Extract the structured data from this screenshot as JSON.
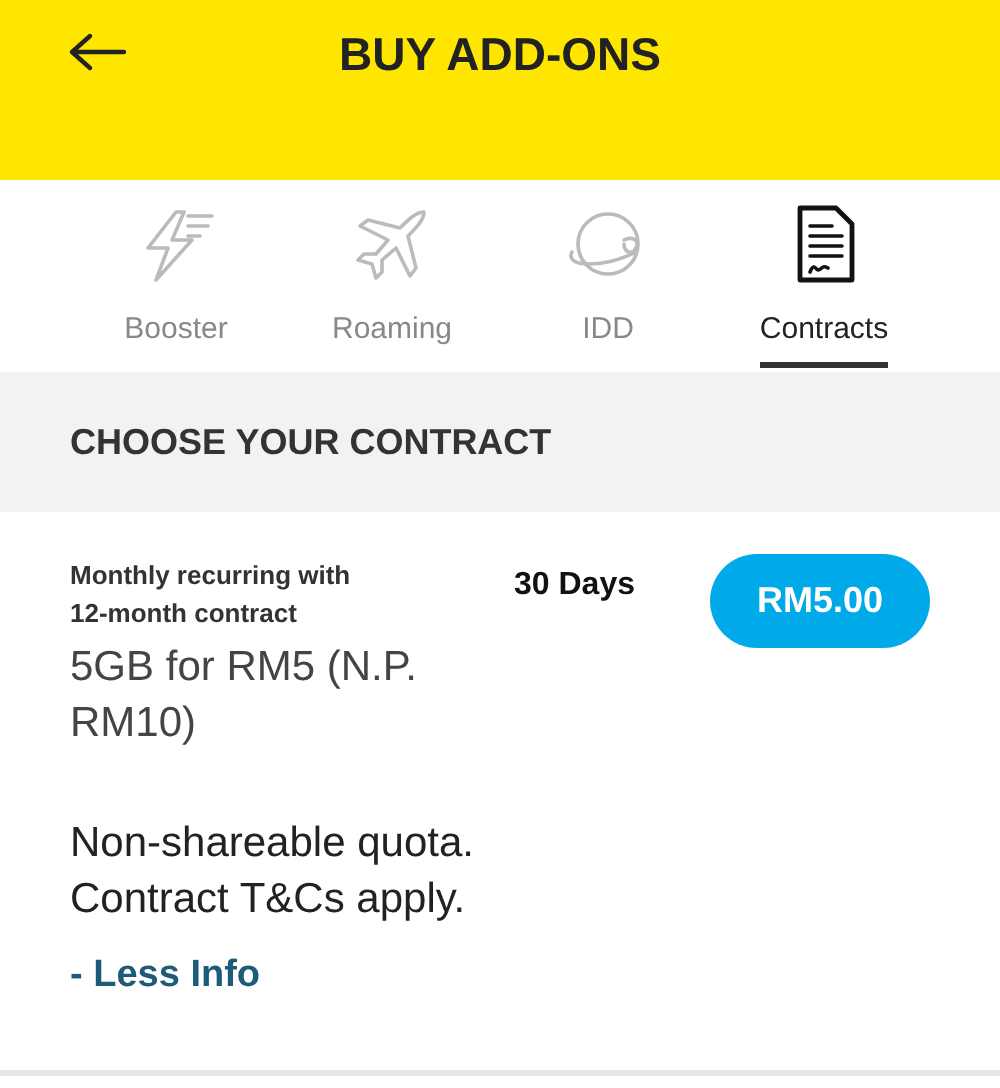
{
  "header": {
    "title": "BUY ADD-ONS"
  },
  "tabs": [
    {
      "label": "Booster",
      "kind": "booster",
      "selected": false
    },
    {
      "label": "Roaming",
      "kind": "roaming",
      "selected": false
    },
    {
      "label": "IDD",
      "kind": "idd",
      "selected": false
    },
    {
      "label": "Contracts",
      "kind": "contracts",
      "selected": true
    }
  ],
  "section": {
    "title": "CHOOSE YOUR CONTRACT"
  },
  "offer": {
    "subtitle": "Monthly recurring with\n12-month contract",
    "validity": "30 Days",
    "price": "RM5.00",
    "name": "5GB for RM5 (N.P.\nRM10)",
    "details": "Non-shareable quota.\nContract T&Cs apply.",
    "toggle": "- Less Info"
  }
}
